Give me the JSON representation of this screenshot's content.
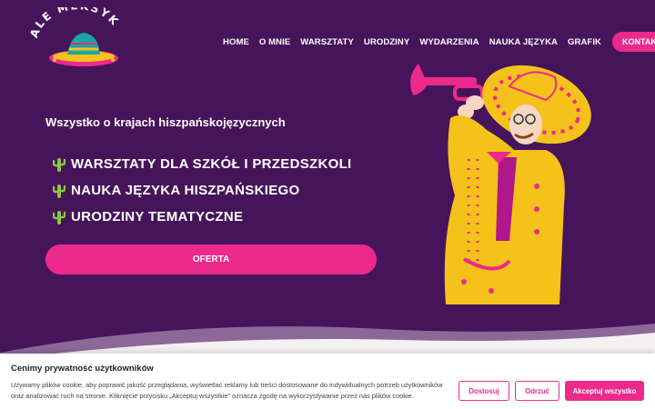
{
  "logo": {
    "text": "ALE MEKSYK"
  },
  "nav": {
    "items": [
      "HOME",
      "O MNIE",
      "WARSZTATY",
      "URODZINY",
      "WYDARZENIA",
      "NAUKA JĘZYKA",
      "GRAFIK"
    ],
    "contact_label": "KONTAKT"
  },
  "hero": {
    "subtitle": "Wszystko o krajach hiszpańskojęzycznych",
    "features": [
      "WARSZTATY DLA SZKÓŁ I PRZEDSZKOLI",
      "NAUKA JĘZYKA HISZPAŃSKIEGO",
      "URODZINY TEMATYCZNE"
    ],
    "cta_label": "OFERTA",
    "feature_icon": "cactus-icon",
    "illustration": "mariachi-trumpet-player"
  },
  "cookie": {
    "title": "Cenimy prywatność użytkowników",
    "text": "Używamy plików cookie, aby poprawić jakość przeglądania, wyświetlać reklamy lub treści dostosowane do indywidualnych potrzeb użytkowników oraz analizować ruch na stronie. Kliknięcie przycisku „Akceptuj wszystkie” oznacza zgodę na wykorzystywanie przez nas plików cookie.",
    "customize_label": "Dostosuj",
    "reject_label": "Odrzuć",
    "accept_label": "Akceptuj wszystko"
  },
  "colors": {
    "background": "#46145a",
    "accent": "#ec2a8c",
    "cactus": "#8cc63f",
    "mariachi_yellow": "#f5c21b",
    "text": "#ffffff"
  }
}
